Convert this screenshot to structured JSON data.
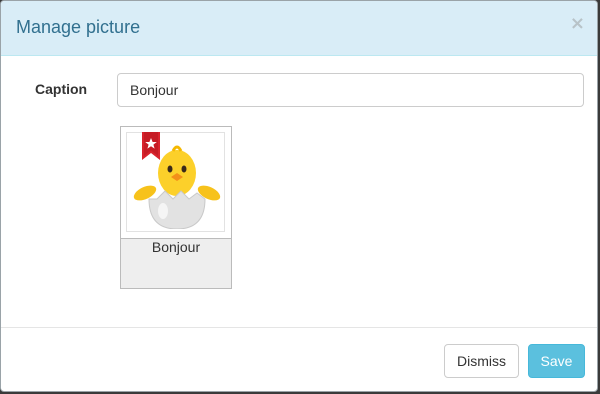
{
  "modal": {
    "title": "Manage picture",
    "close_label": "×"
  },
  "form": {
    "caption_label": "Caption",
    "caption_value": "Bonjour"
  },
  "thumbnail": {
    "caption": "Bonjour",
    "badge_icon": "star-icon",
    "image_icon": "hatching-chick-icon"
  },
  "footer": {
    "dismiss_label": "Dismiss",
    "save_label": "Save"
  },
  "colors": {
    "header_bg": "#d9edf7",
    "title": "#31708f",
    "save_bg": "#5bc0de",
    "badge": "#d9232d"
  }
}
